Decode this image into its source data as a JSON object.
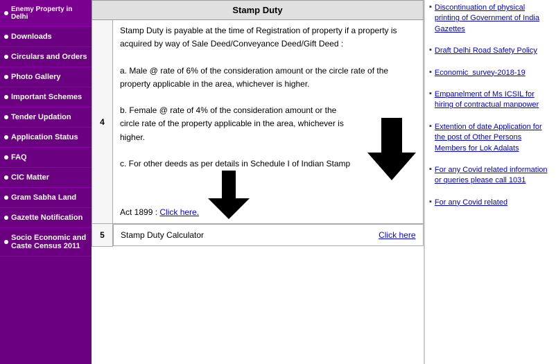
{
  "sidebar": {
    "items": [
      {
        "id": "enemy-property",
        "label": "Enemy Property in Delhi",
        "bullet": true,
        "enemy": true
      },
      {
        "id": "downloads",
        "label": "Downloads",
        "bullet": true
      },
      {
        "id": "circulars-orders",
        "label": "Circulars and Orders",
        "bullet": true
      },
      {
        "id": "photo-gallery",
        "label": "Photo Gallery",
        "bullet": true
      },
      {
        "id": "important-schemes",
        "label": "Important Schemes",
        "bullet": true
      },
      {
        "id": "tender-updation",
        "label": "Tender Updation",
        "bullet": true
      },
      {
        "id": "application-status",
        "label": "Application Status",
        "bullet": true
      },
      {
        "id": "faq",
        "label": "FAQ",
        "bullet": true
      },
      {
        "id": "cic-matter",
        "label": "CIC Matter",
        "bullet": true
      },
      {
        "id": "gram-sabha-land",
        "label": "Gram Sabha Land",
        "bullet": true
      },
      {
        "id": "gazette-notification",
        "label": "Gazette Notification",
        "bullet": true
      },
      {
        "id": "socio-economic",
        "label": "Socio Economic and Caste Census 2011",
        "bullet": true
      }
    ]
  },
  "main": {
    "table_header": "Stamp Duty",
    "row4_num": "4",
    "row4_content_line1": "Stamp Duty is payable at the time of Registration of property if a property is acquired by way of Sale Deed/Conveyance Deed/Gift Deed :",
    "row4_content_a": "a.  Male @ rate of 6% of the consideration amount or the circle rate of the property applicable in the area, whichever is higher.",
    "row4_content_b": "b.  Female @ rate of 4% of the consideration amount or the circle rate of the property applicable in the area, whichever is higher.",
    "row4_content_c_prefix": "c.  For other deeds as per details in Schedule I of Indian Stamp Act 1899 : ",
    "row4_content_c_link": "Click here.",
    "row5_num": "5",
    "row5_label": "Stamp Duty Calculator",
    "row5_link": "Click here"
  },
  "right_panel": {
    "items": [
      {
        "id": "discontinuation",
        "text": "Discontinuation of physical printing of Government of India Gazettes"
      },
      {
        "id": "draft-delhi",
        "text": "Draft Delhi Road Safety Policy"
      },
      {
        "id": "economic-survey",
        "text": "Economic_survey-2018-19"
      },
      {
        "id": "empanelment",
        "text": "Empanelment of Ms ICSIL for hiring of contractual manpower"
      },
      {
        "id": "extension",
        "text": "Extention of date Application for the post of Other Persons Members for Lok Adalats"
      },
      {
        "id": "covid",
        "text": "For any Covid related information or queries please call 1031"
      },
      {
        "id": "covid2",
        "text": "For any Covid related"
      }
    ]
  }
}
